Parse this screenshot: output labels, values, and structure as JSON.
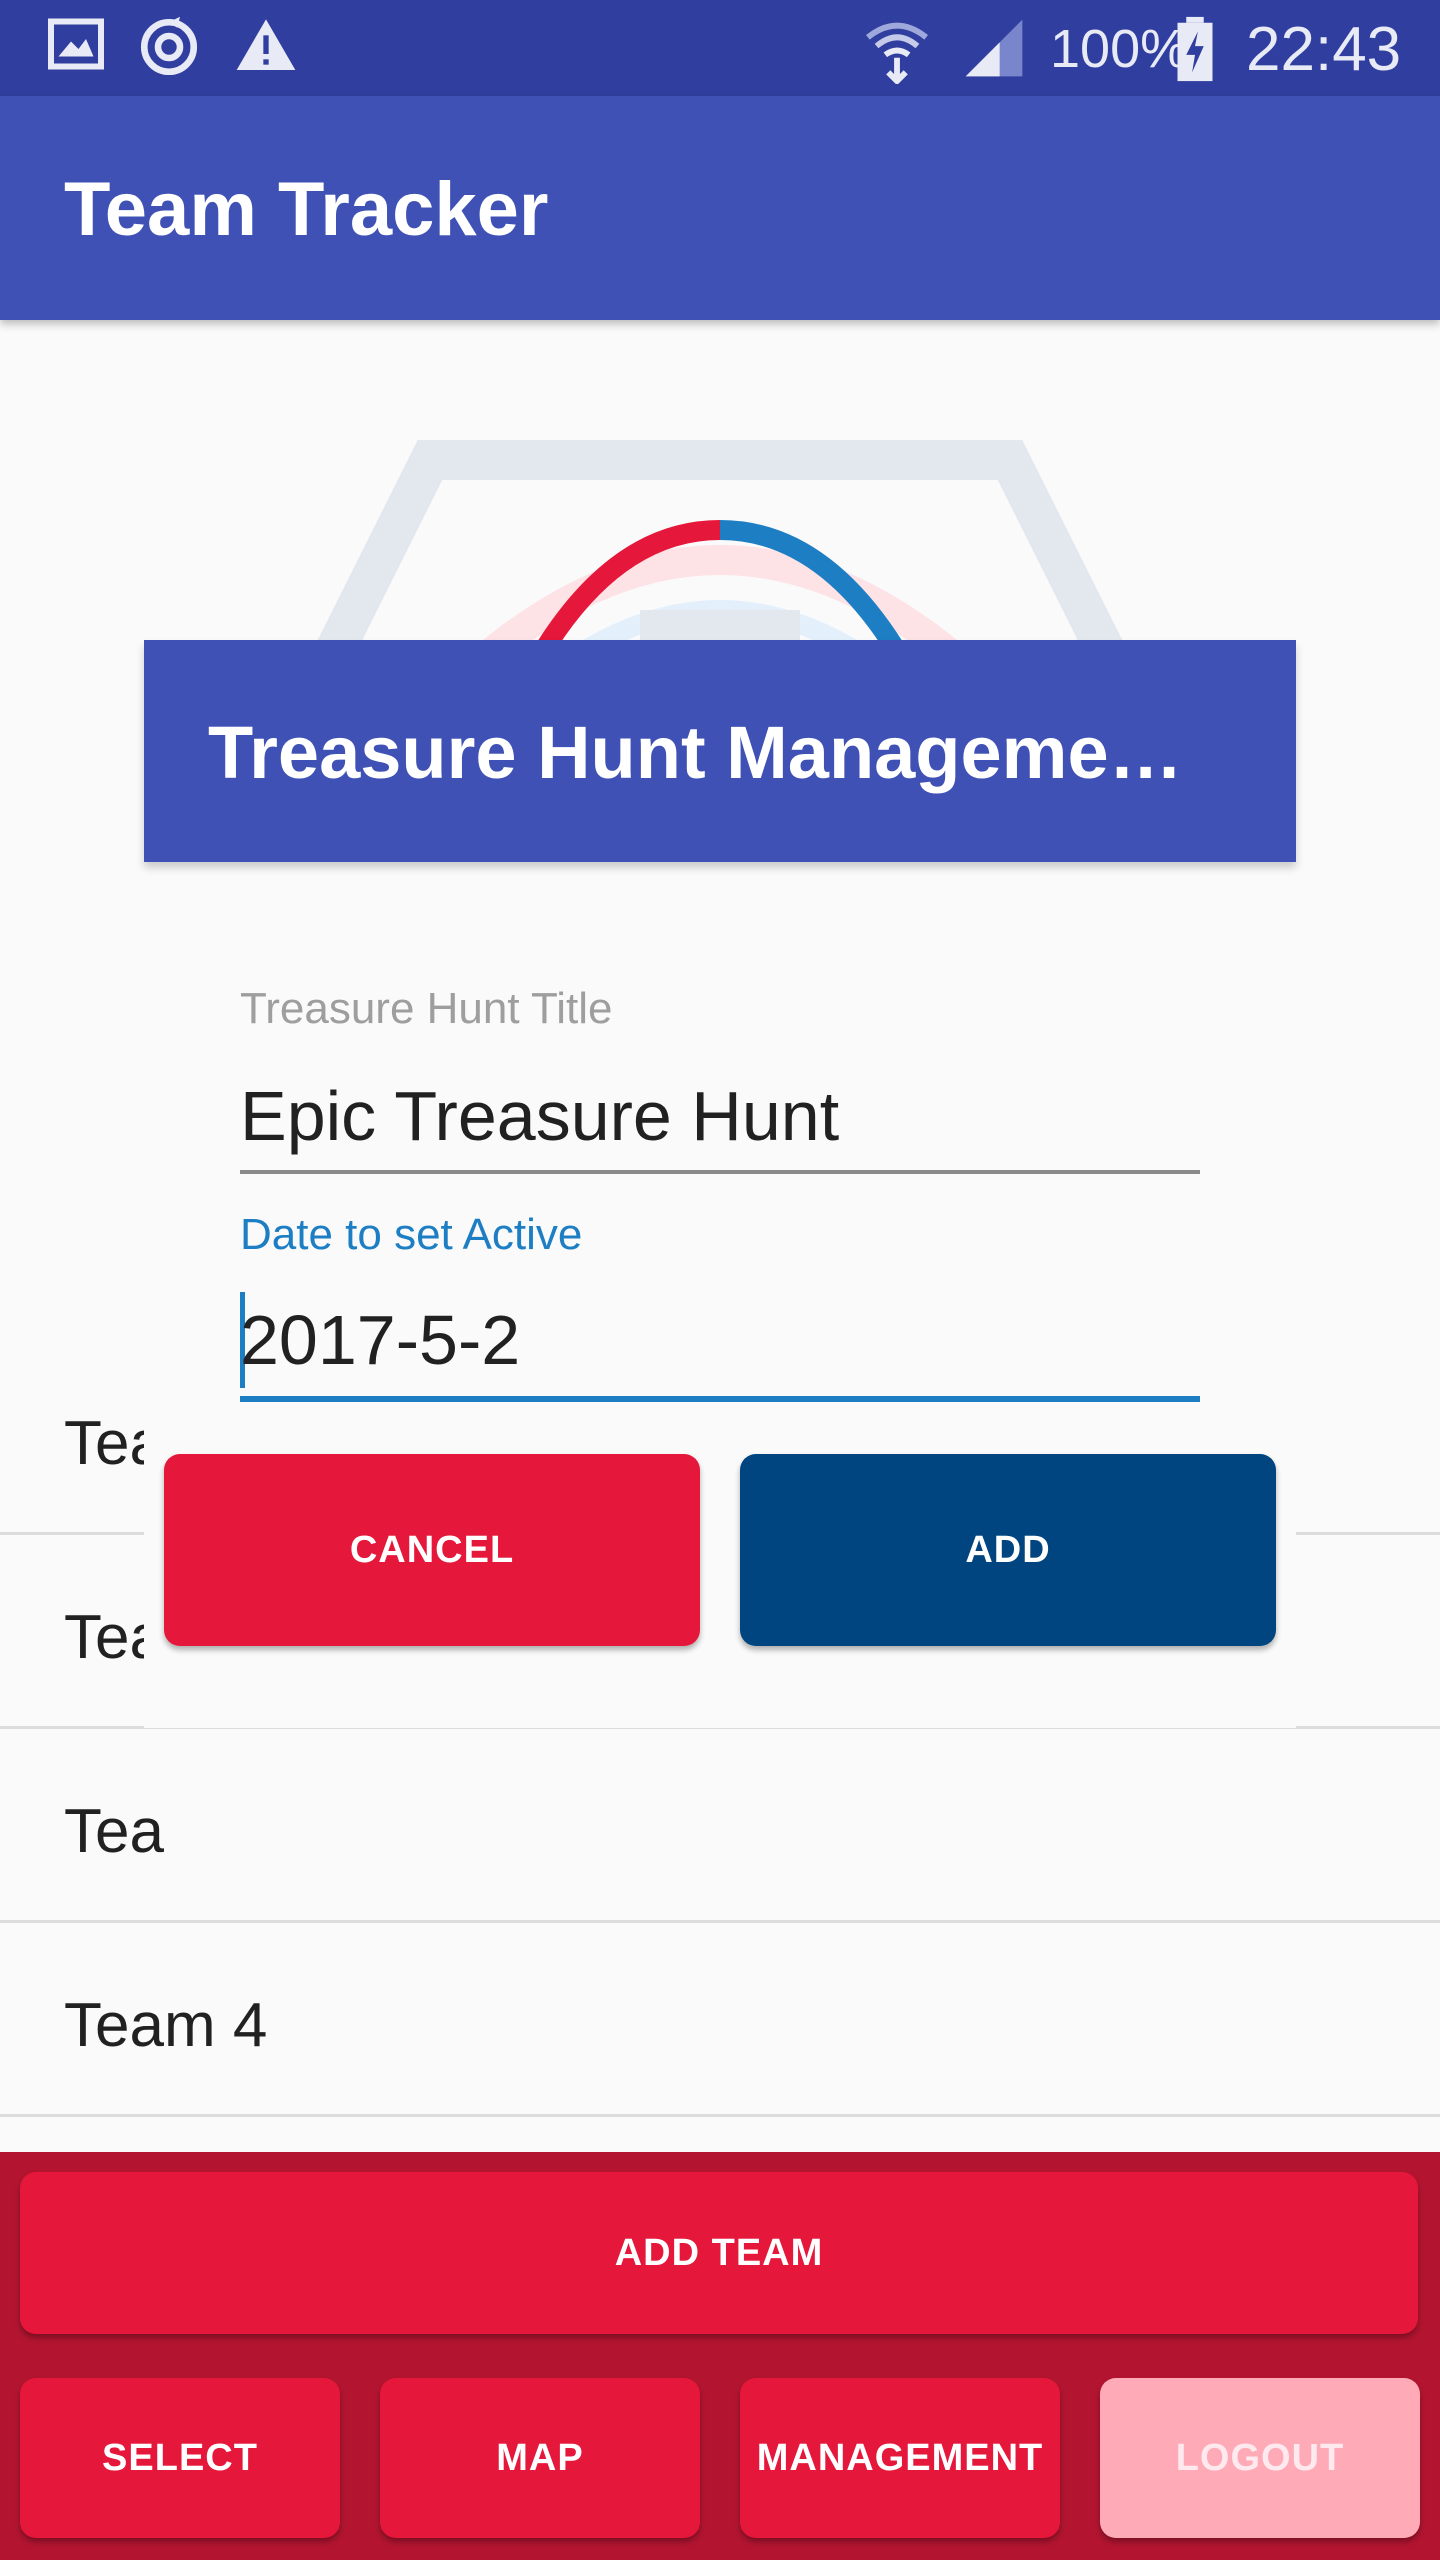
{
  "status_bar": {
    "battery": "100%",
    "time": "22:43",
    "icons": [
      "image-icon",
      "sync-icon",
      "warning-icon",
      "wifi-icon",
      "signal-icon",
      "battery-charging-icon"
    ]
  },
  "app_bar": {
    "title": "Team Tracker"
  },
  "team_list": [
    {
      "label": "Tea"
    },
    {
      "label": "Tea"
    },
    {
      "label": "Tea"
    },
    {
      "label": "Team 4"
    }
  ],
  "dialog": {
    "title": "Treasure Hunt Manageme…",
    "title_field": {
      "label": "Treasure Hunt Title",
      "value": "Epic Treasure Hunt"
    },
    "date_field": {
      "label": "Date to set Active",
      "value": "2017-5-2"
    },
    "cancel_label": "CANCEL",
    "add_label": "ADD"
  },
  "actions": {
    "add_team": "ADD TEAM",
    "select": "SELECT",
    "map": "MAP",
    "management": "MANAGEMENT",
    "logout": "LOGOUT"
  },
  "colors": {
    "primary": "#3f51b5",
    "primary_dark": "#303f9f",
    "accent_red": "#e5173a",
    "bottom_bar": "#b31530",
    "navy": "#00457f",
    "field_focus": "#1e7ec4"
  }
}
